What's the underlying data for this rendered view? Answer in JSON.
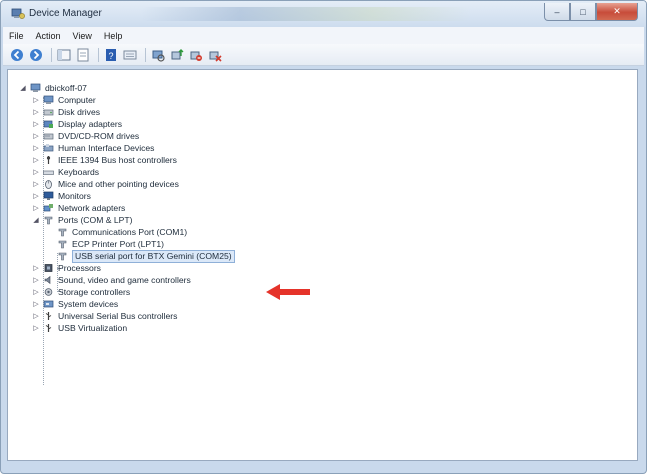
{
  "window": {
    "title": "Device Manager",
    "controls": {
      "minimize": "–",
      "maximize": "□",
      "close": "✕"
    }
  },
  "menu": [
    {
      "label": "File"
    },
    {
      "label": "Action"
    },
    {
      "label": "View"
    },
    {
      "label": "Help"
    }
  ],
  "toolbar_icons": [
    "back-arrow-icon",
    "forward-arrow-icon",
    "separator",
    "console-tree-icon",
    "properties-sheet-icon",
    "separator",
    "help-icon",
    "view-icon",
    "separator",
    "scan-hardware-icon",
    "update-driver-icon",
    "disable-device-icon",
    "uninstall-device-icon"
  ],
  "tree": {
    "root": "dbickoff-07",
    "categories": [
      {
        "label": "Computer",
        "icon": "computer-icon",
        "expanded": false
      },
      {
        "label": "Disk drives",
        "icon": "disk-drive-icon",
        "expanded": false
      },
      {
        "label": "Display adapters",
        "icon": "display-adapter-icon",
        "expanded": false
      },
      {
        "label": "DVD/CD-ROM drives",
        "icon": "dvd-drive-icon",
        "expanded": false
      },
      {
        "label": "Human Interface Devices",
        "icon": "hid-icon",
        "expanded": false
      },
      {
        "label": "IEEE 1394 Bus host controllers",
        "icon": "ieee1394-icon",
        "expanded": false
      },
      {
        "label": "Keyboards",
        "icon": "keyboard-icon",
        "expanded": false
      },
      {
        "label": "Mice and other pointing devices",
        "icon": "mouse-icon",
        "expanded": false
      },
      {
        "label": "Monitors",
        "icon": "monitor-icon",
        "expanded": false
      },
      {
        "label": "Network adapters",
        "icon": "network-adapter-icon",
        "expanded": false
      },
      {
        "label": "Ports (COM & LPT)",
        "icon": "port-icon",
        "expanded": true,
        "children": [
          {
            "label": "Communications Port (COM1)",
            "icon": "port-icon",
            "selected": false
          },
          {
            "label": "ECP Printer Port (LPT1)",
            "icon": "port-icon",
            "selected": false
          },
          {
            "label": "USB serial port for BTX Gemini (COM25)",
            "icon": "port-icon",
            "selected": true
          }
        ]
      },
      {
        "label": "Processors",
        "icon": "processor-icon",
        "expanded": false
      },
      {
        "label": "Sound, video and game controllers",
        "icon": "sound-icon",
        "expanded": false
      },
      {
        "label": "Storage controllers",
        "icon": "storage-controller-icon",
        "expanded": false
      },
      {
        "label": "System devices",
        "icon": "system-device-icon",
        "expanded": false
      },
      {
        "label": "Universal Serial Bus controllers",
        "icon": "usb-icon",
        "expanded": false
      },
      {
        "label": "USB Virtualization",
        "icon": "usb-icon",
        "expanded": false
      }
    ]
  },
  "annotation": {
    "color": "#e5332a",
    "icon": "pointer-arrow-icon"
  }
}
